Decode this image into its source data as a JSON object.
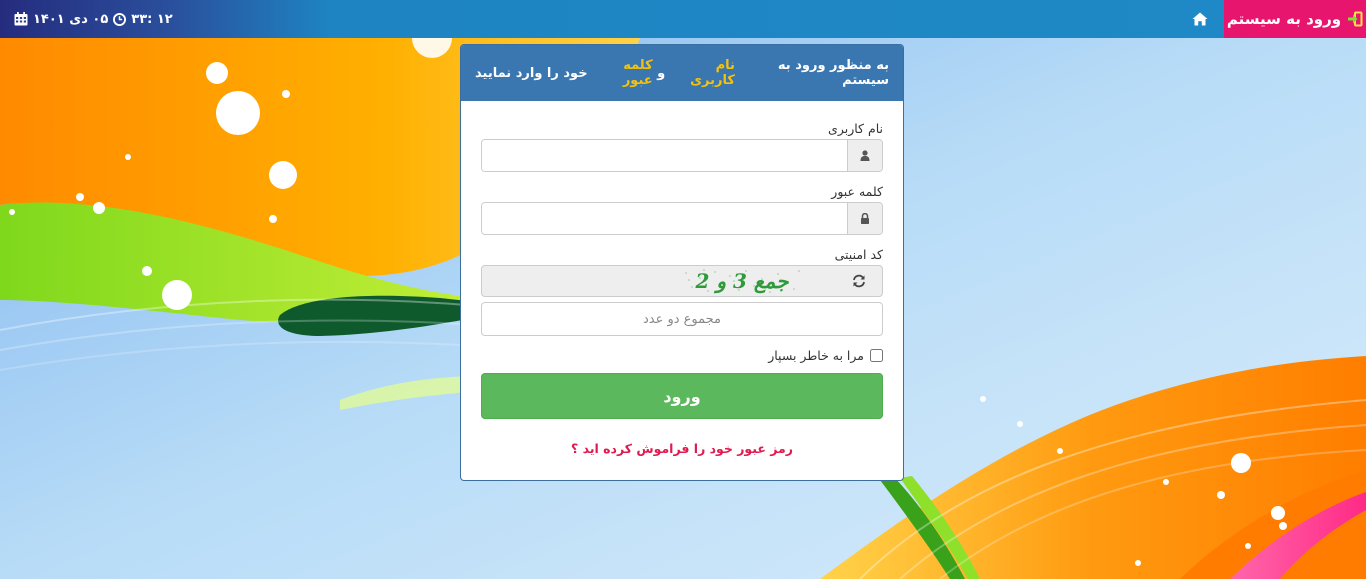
{
  "navbar": {
    "brand_label": "ورود به سیستم",
    "brand_color": "#e8156f",
    "home_icon": "home-icon",
    "clock_text": "۳۳: ۱۲",
    "date_text": "۰۵ دی ۱۴۰۱"
  },
  "panel": {
    "heading_part1": "به منظور ورود به سیستم ",
    "heading_highlight1": "نام کاربری",
    "heading_part2": " و ",
    "heading_highlight2": "کلمه عبور",
    "heading_part3": " خود را وارد نمایید",
    "header_color": "#3a77b0",
    "highlight_color": "#f4c20d"
  },
  "form": {
    "username_label": "نام کاربری",
    "username_value": "",
    "password_label": "کلمه عبور",
    "password_value": "",
    "captcha_label": "کد امنیتی",
    "captcha_text": "جمع 3 و 2",
    "sum_placeholder": "مجموع دو عدد",
    "remember_label": "مرا به خاطر بسپار",
    "remember_checked": false,
    "login_button": "ورود",
    "login_color": "#5cb85c",
    "forgot_link": "رمز عبور خود را فراموش کرده اید ؟",
    "forgot_color": "#e01a4f"
  }
}
